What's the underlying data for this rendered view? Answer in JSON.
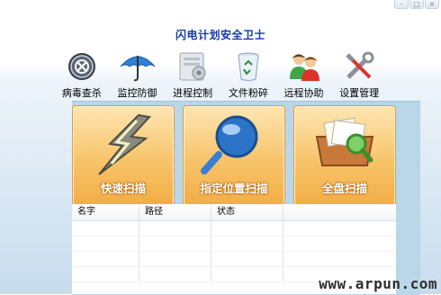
{
  "window": {
    "title": "闪电计划安全卫士",
    "controls": [
      "-",
      "□",
      "×"
    ]
  },
  "toolbar": {
    "items": [
      {
        "label": "病毒查杀",
        "icon": "virus-scan-icon"
      },
      {
        "label": "监控防御",
        "icon": "umbrella-icon"
      },
      {
        "label": "进程控制",
        "icon": "process-control-icon"
      },
      {
        "label": "文件粉碎",
        "icon": "recycle-bin-icon"
      },
      {
        "label": "远程协助",
        "icon": "users-icon"
      },
      {
        "label": "设置管理",
        "icon": "tools-icon"
      }
    ]
  },
  "actions": {
    "quick_scan": {
      "label": "快速扫描",
      "icon": "lightning-icon"
    },
    "custom_scan": {
      "label": "指定位置扫描",
      "icon": "magnifier-icon"
    },
    "full_scan": {
      "label": "全盘扫描",
      "icon": "box-magnifier-icon"
    }
  },
  "results": {
    "columns": {
      "name": "名字",
      "path": "路径",
      "status": "状态"
    }
  },
  "watermark": "www.arpun.com"
}
